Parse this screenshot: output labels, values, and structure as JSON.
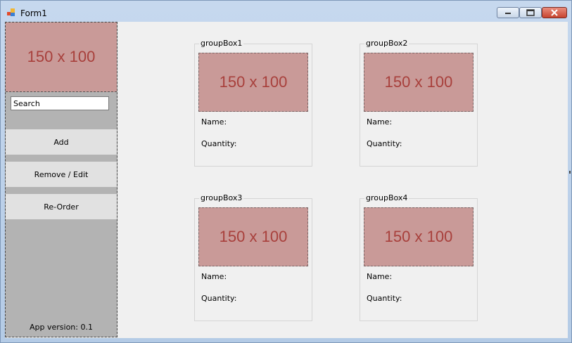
{
  "window": {
    "title": "Form1",
    "controls": {
      "minimize": "minimize-button",
      "maximize": "maximize-button",
      "close": "close-button"
    }
  },
  "sidebar": {
    "logo_placeholder": "150 x 100",
    "search": {
      "value": "Search"
    },
    "buttons": [
      {
        "label": "Add"
      },
      {
        "label": "Remove / Edit"
      },
      {
        "label": "Re-Order"
      }
    ],
    "version": "App version: 0.1"
  },
  "main": {
    "groups": [
      {
        "title": "groupBox1",
        "image": "150 x 100",
        "name_label": "Name:",
        "quantity_label": "Quantity:"
      },
      {
        "title": "groupBox2",
        "image": "150 x 100",
        "name_label": "Name:",
        "quantity_label": "Quantity:"
      },
      {
        "title": "groupBox3",
        "image": "150 x 100",
        "name_label": "Name:",
        "quantity_label": "Quantity:"
      },
      {
        "title": "groupBox4",
        "image": "150 x 100",
        "name_label": "Name:",
        "quantity_label": "Quantity:"
      }
    ]
  },
  "colors": {
    "placeholder_bg": "#c99a98",
    "placeholder_text": "#a8403c",
    "sidebar_bg": "#b3b3b3",
    "client_bg": "#f0f0f0"
  }
}
